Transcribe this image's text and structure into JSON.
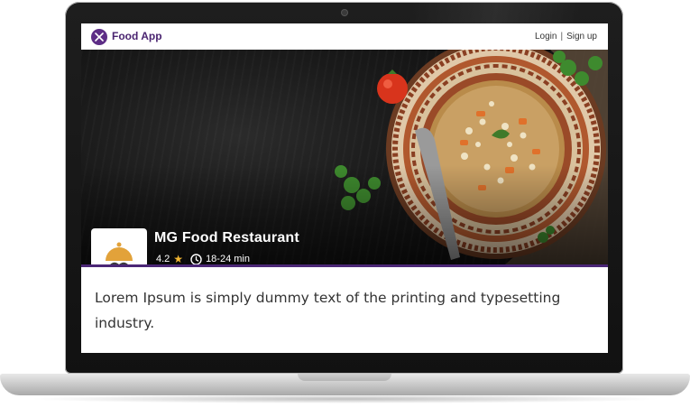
{
  "navbar": {
    "brand": "Food App",
    "login": "Login",
    "separator": "|",
    "signup": "Sign up"
  },
  "restaurant": {
    "name": "MG Food Restaurant",
    "rating": "4.2",
    "delivery_time": "18-24 min",
    "icons": [
      "utensils-logo-icon",
      "star-icon",
      "clock-icon",
      "cloche-icon"
    ]
  },
  "description": "Lorem Ipsum is simply dummy text of the printing and typesetting industry.",
  "colors": {
    "brand_purple": "#4b2676",
    "star": "#f2b632",
    "hero_bg": "#1a1a1a"
  }
}
